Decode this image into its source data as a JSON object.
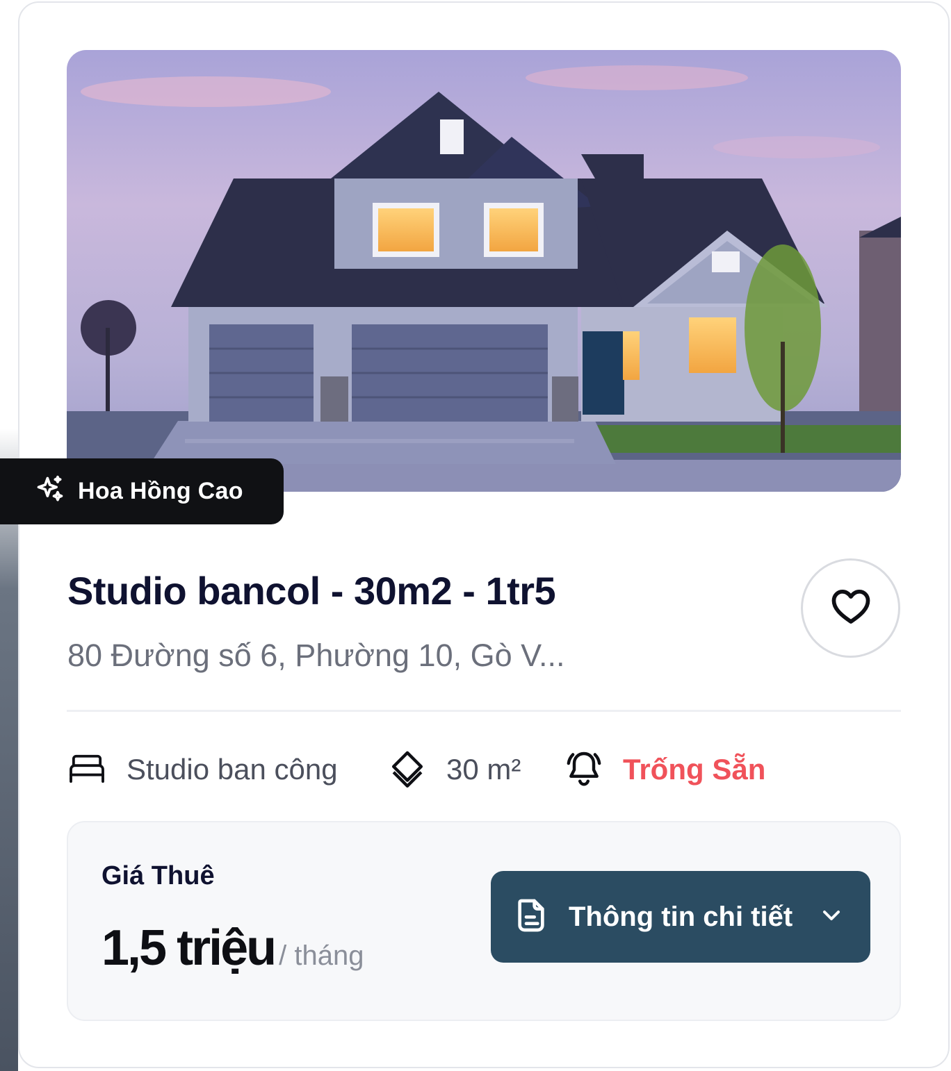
{
  "badge": {
    "label": "Hoa Hồng Cao",
    "icon": "sparkles-icon"
  },
  "listing": {
    "title": "Studio bancol - 30m2 - 1tr5",
    "address": "80 Đường số 6, Phường 10, Gò V..."
  },
  "features": [
    {
      "icon": "bed-icon",
      "label": "Studio ban công"
    },
    {
      "icon": "area-icon",
      "label": "30 m²"
    },
    {
      "icon": "bell-icon",
      "label": "Trống Sẵn"
    }
  ],
  "price": {
    "label": "Giá Thuê",
    "amount": "1,5 triệu",
    "unit": "/ tháng"
  },
  "detail_button": {
    "label": "Thông tin chi tiết",
    "icon": "document-icon"
  },
  "colors": {
    "primary_button": "#2b4c62",
    "status_available": "#f0525a",
    "badge_bg": "#101114"
  }
}
